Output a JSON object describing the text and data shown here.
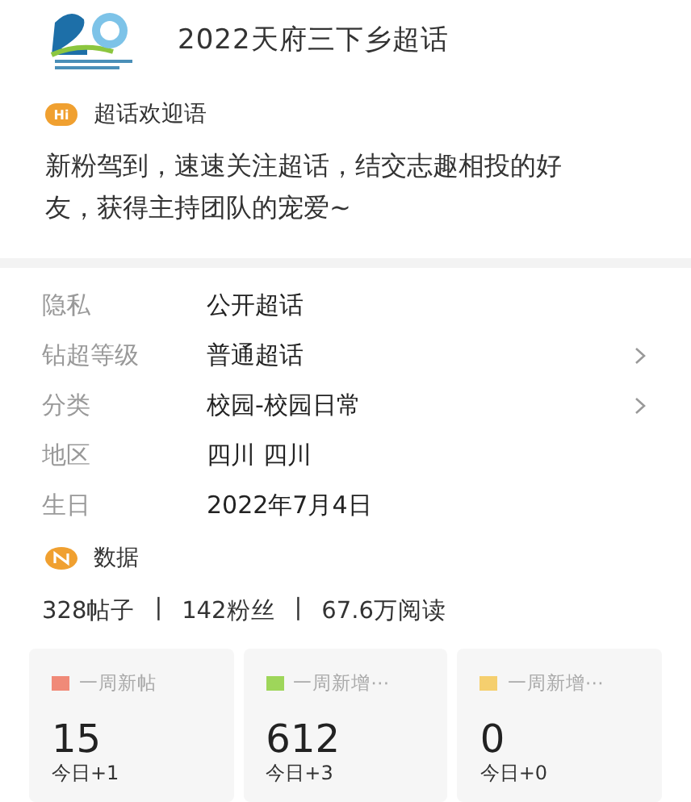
{
  "header": {
    "title": "2022天府三下乡超话"
  },
  "welcome": {
    "badge": "Hi",
    "heading": "超话欢迎语",
    "text": "新粉驾到，速速关注超话，结交志趣相投的好友，获得主持团队的宠爱~"
  },
  "info_rows": [
    {
      "label": "隐私",
      "value": "公开超话",
      "has_arrow": false
    },
    {
      "label": "钻超等级",
      "value": "普通超话",
      "has_arrow": true
    },
    {
      "label": "分类",
      "value": "校园-校园日常",
      "has_arrow": true
    },
    {
      "label": "地区",
      "value": "四川 四川",
      "has_arrow": false
    },
    {
      "label": "生日",
      "value": "2022年7月4日",
      "has_arrow": false
    }
  ],
  "data": {
    "heading": "数据",
    "summary": [
      "328帖子",
      "142粉丝",
      "67.6万阅读"
    ],
    "separator": "|",
    "cards": [
      {
        "title": "一周新帖",
        "color": "#f08a78",
        "value": "15",
        "today": "今日+1"
      },
      {
        "title": "一周新增⋯",
        "color": "#9ed65a",
        "value": "612",
        "today": "今日+3"
      },
      {
        "title": "一周新增⋯",
        "color": "#f5cf6e",
        "value": "0",
        "today": "今日+0"
      }
    ]
  }
}
